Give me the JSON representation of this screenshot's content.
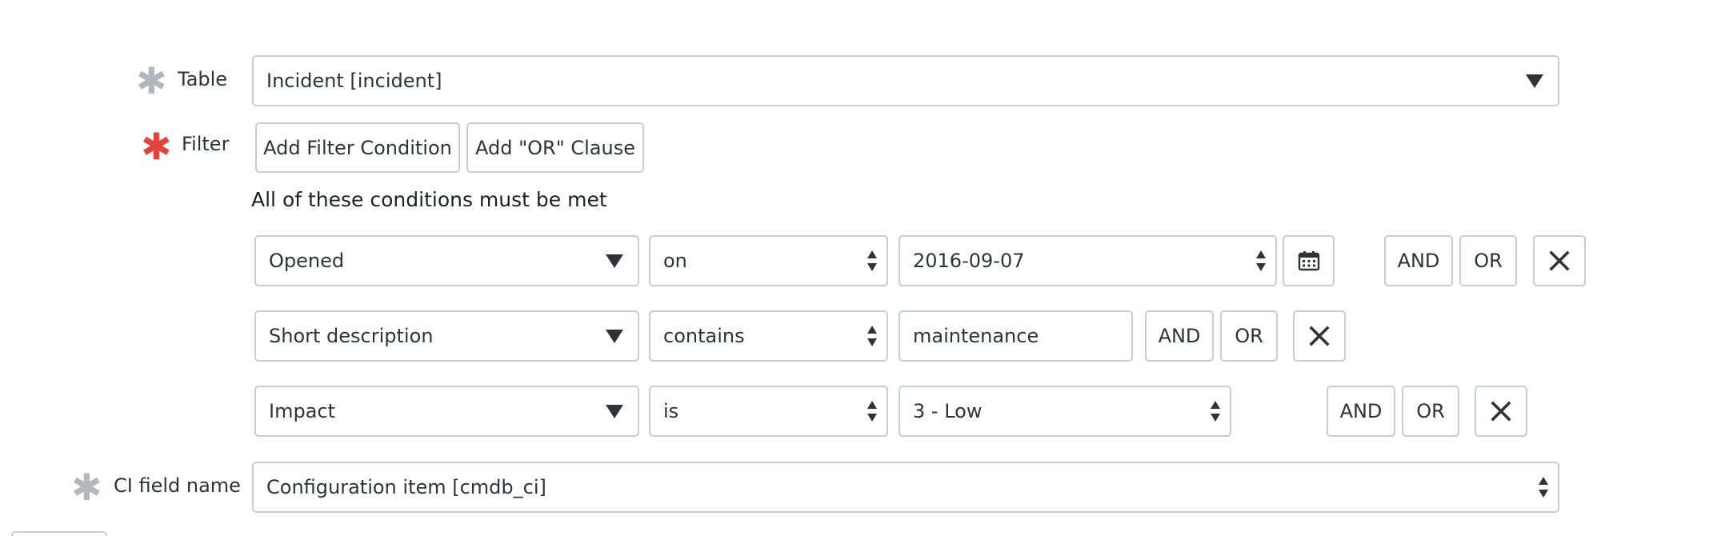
{
  "table": {
    "label": "Table",
    "value": "Incident [incident]"
  },
  "filter": {
    "label": "Filter",
    "add_condition_label": "Add Filter Condition",
    "add_or_label": "Add \"OR\" Clause",
    "conditions_heading": "All of these conditions must be met",
    "rows": [
      {
        "field": "Opened",
        "operator": "on",
        "value": "2016-09-07",
        "and_label": "AND",
        "or_label": "OR"
      },
      {
        "field": "Short description",
        "operator": "contains",
        "value": "maintenance",
        "and_label": "AND",
        "or_label": "OR"
      },
      {
        "field": "Impact",
        "operator": "is",
        "value": "3 - Low",
        "and_label": "AND",
        "or_label": "OR"
      }
    ]
  },
  "ci_field": {
    "label": "CI field name",
    "value": "Configuration item [cmdb_ci]"
  },
  "colors": {
    "required_mandatory": "#e5413b",
    "required_satisfied": "#b3b6ba",
    "border": "#c9ccd0",
    "text": "#2f3237"
  },
  "icons": {
    "calendar": "calendar-icon",
    "remove": "close-icon",
    "dropdown": "chevron-down-icon",
    "select": "select-arrows-icon"
  }
}
